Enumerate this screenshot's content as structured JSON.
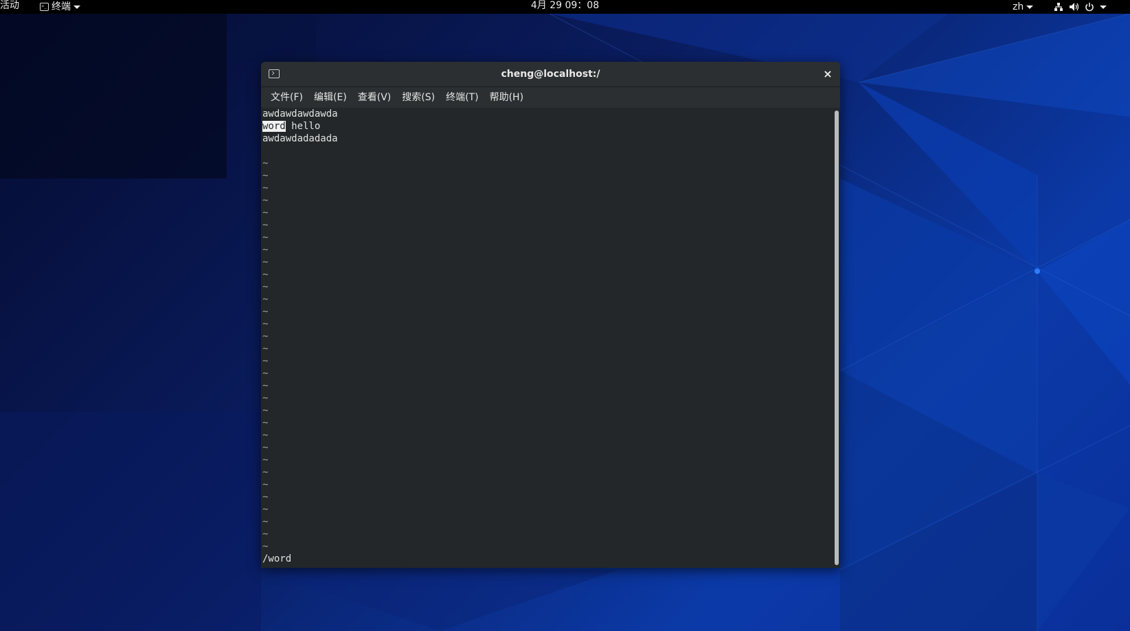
{
  "topbar": {
    "activities": "活动",
    "app_name": "终端",
    "clock": "4月 29  09：08",
    "lang": "zh",
    "icons": [
      "network-icon",
      "volume-icon",
      "power-icon"
    ]
  },
  "window": {
    "title": "cheng@localhost:/",
    "close": "×",
    "menu": [
      "文件(F)",
      "编辑(E)",
      "查看(V)",
      "搜索(S)",
      "终端(T)",
      "帮助(H)"
    ]
  },
  "terminal": {
    "line1": "awdawdawdawda",
    "line2_match": "word",
    "line2_rest": " hello",
    "line3": "awdawdadadada",
    "tilde": "~",
    "command": "/word"
  },
  "colors": {
    "terminal_bg": "#232729",
    "titlebar_bg": "#2b2f31",
    "desktop_blue": "#0b3aa8"
  }
}
